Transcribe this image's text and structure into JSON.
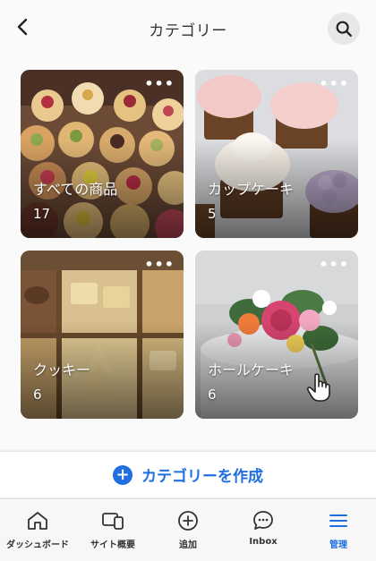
{
  "header": {
    "title": "カテゴリー",
    "back_icon": "chevron-left-icon",
    "search_icon": "search-icon"
  },
  "categories": [
    {
      "name": "すべての商品",
      "count": "17",
      "more": "•••",
      "image": "assorted-pastries-photo"
    },
    {
      "name": "カップケーキ",
      "count": "5",
      "more": "•••",
      "image": "cupcakes-photo"
    },
    {
      "name": "クッキー",
      "count": "6",
      "more": "•••",
      "image": "cookies-box-photo"
    },
    {
      "name": "ホールケーキ",
      "count": "6",
      "more": "•••",
      "image": "floral-cake-photo"
    }
  ],
  "create_button": {
    "label": "カテゴリーを作成",
    "icon": "plus-circle-icon",
    "color": "#1f6fe0"
  },
  "tabbar": {
    "items": [
      {
        "label": "ダッシュボード",
        "icon": "home-icon"
      },
      {
        "label": "サイト概要",
        "icon": "devices-icon"
      },
      {
        "label": "追加",
        "icon": "plus-circle-icon"
      },
      {
        "label": "Inbox",
        "icon": "chat-bubble-icon"
      },
      {
        "label": "管理",
        "icon": "menu-icon",
        "active": true
      }
    ],
    "active_color": "#1f6fe0"
  }
}
